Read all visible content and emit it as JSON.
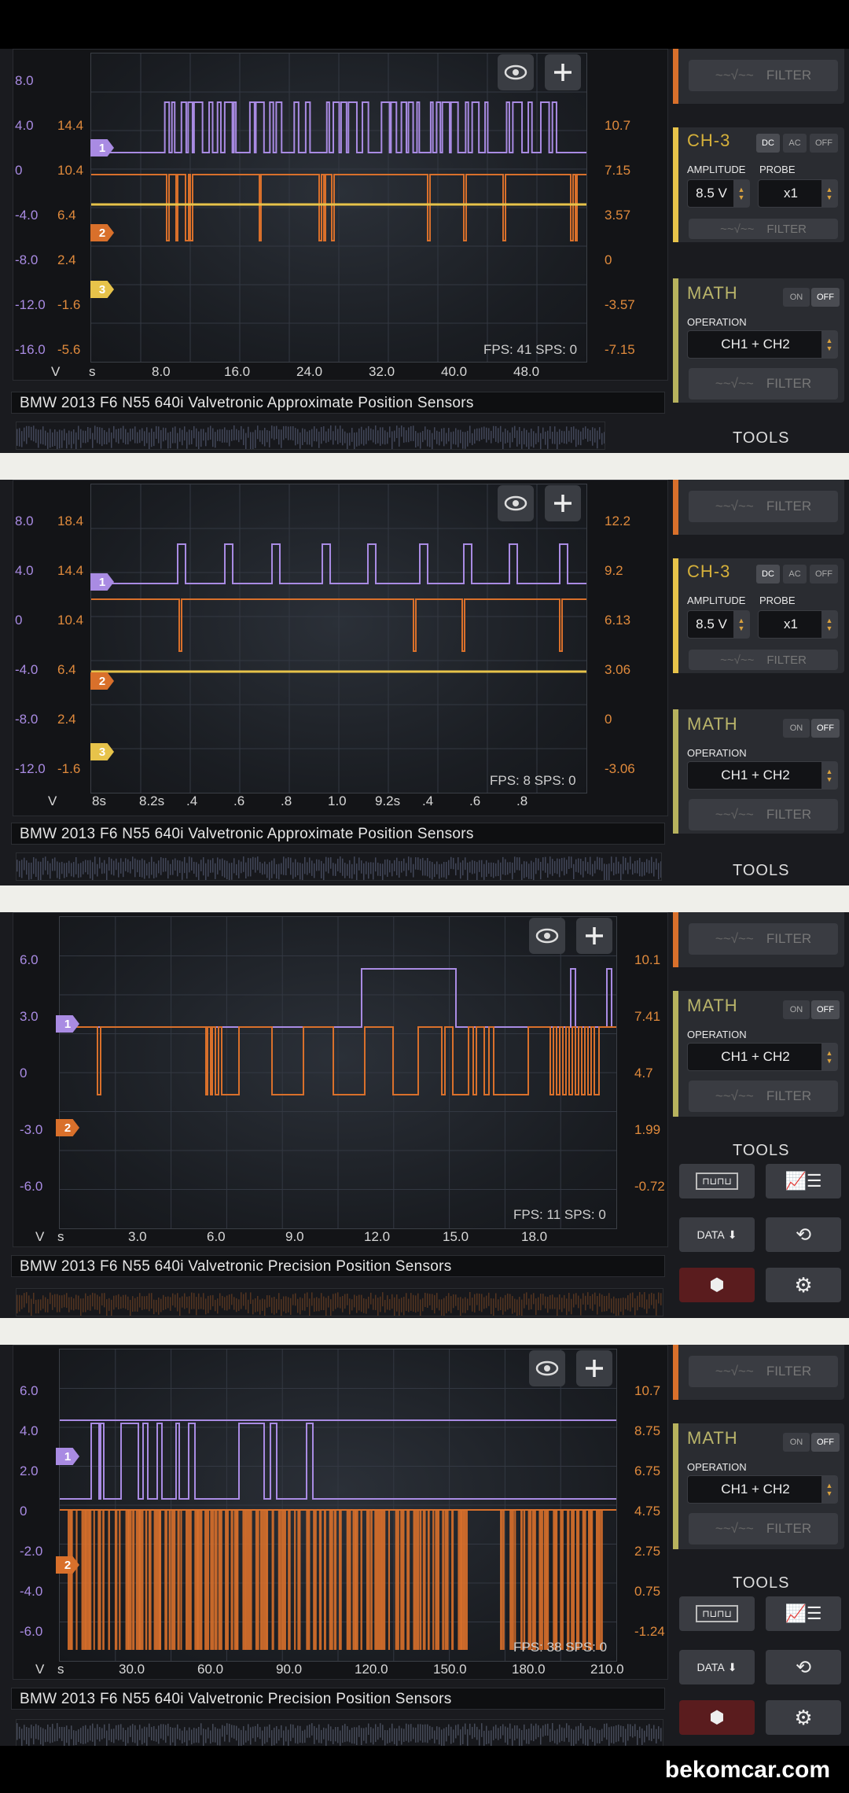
{
  "channel_colors": {
    "ch1": "#a98be3",
    "ch2": "#d9702b",
    "ch3": "#e7c34a",
    "math": "#b7b25d",
    "ch3_title": "#d6b13a"
  },
  "scopes": [
    {
      "title": "BMW 2013 F6 N55 640i Valvetronic Approximate Position Sensors",
      "left_axis_v": [
        "8.0",
        "4.0",
        "0",
        "-4.0",
        "-8.0",
        "-12.0",
        "-16.0"
      ],
      "left_axis_ch2": [
        "",
        "14.4",
        "10.4",
        "6.4",
        "2.4",
        "-1.6",
        "-5.6"
      ],
      "right_axis": [
        "",
        "10.7",
        "7.15",
        "3.57",
        "0",
        "-3.57",
        "-7.15"
      ],
      "x_ticks": [
        "8.0",
        "16.0",
        "24.0",
        "32.0",
        "40.0",
        "48.0"
      ],
      "x_unit_v": "V",
      "x_unit_s": "s",
      "fps": "FPS: 41  SPS: 0",
      "markers": [
        "1",
        "2",
        "3"
      ]
    },
    {
      "title": "BMW 2013 F6 N55 640i Valvetronic Approximate Position Sensors",
      "left_axis_v": [
        "8.0",
        "4.0",
        "0",
        "-4.0",
        "-8.0",
        "-12.0"
      ],
      "left_axis_ch2": [
        "18.4",
        "14.4",
        "10.4",
        "6.4",
        "2.4",
        "-1.6"
      ],
      "right_axis": [
        "12.2",
        "9.2",
        "6.13",
        "3.06",
        "0",
        "-3.06"
      ],
      "x_ticks": [
        "8s",
        "8.2s",
        ".4",
        ".6",
        ".8",
        "1.0",
        "9.2s",
        ".4",
        ".6",
        ".8"
      ],
      "x_unit_v": "V",
      "x_unit_s": "",
      "fps": "FPS: 8  SPS: 0",
      "markers": [
        "1",
        "2",
        "3"
      ]
    },
    {
      "title": "BMW 2013 F6 N55 640i Valvetronic Precision Position Sensors",
      "left_axis_v": [
        "6.0",
        "3.0",
        "0",
        "-3.0",
        "-6.0"
      ],
      "right_axis": [
        "10.1",
        "7.41",
        "4.7",
        "1.99",
        "-0.72"
      ],
      "x_ticks": [
        "3.0",
        "6.0",
        "9.0",
        "12.0",
        "15.0",
        "18.0"
      ],
      "x_unit_v": "V",
      "x_unit_s": "s",
      "fps": "FPS: 11  SPS: 0",
      "markers": [
        "1",
        "2"
      ]
    },
    {
      "title": "BMW 2013 F6 N55 640i Valvetronic Precision Position Sensors",
      "left_axis_v": [
        "6.0",
        "4.0",
        "2.0",
        "0",
        "-2.0",
        "-4.0",
        "-6.0"
      ],
      "right_axis": [
        "10.7",
        "8.75",
        "6.75",
        "4.75",
        "2.75",
        "0.75",
        "-1.24"
      ],
      "x_ticks": [
        "30.0",
        "60.0",
        "90.0",
        "120.0",
        "150.0",
        "180.0",
        "210.0"
      ],
      "x_unit_v": "V",
      "x_unit_s": "s",
      "fps": "FPS: 38  SPS: 0",
      "markers": [
        "1",
        "2"
      ]
    }
  ],
  "sidebar": {
    "filter_label": "FILTER",
    "ch3": {
      "title": "CH-3",
      "dc": "DC",
      "ac": "AC",
      "off": "OFF",
      "amplitude_label": "AMPLITUDE",
      "probe_label": "PROBE",
      "amplitude_value": "8.5 V",
      "probe_value": "x1"
    },
    "math": {
      "title": "MATH",
      "on": "ON",
      "off": "OFF",
      "operation_label": "OPERATION",
      "operation_value": "CH1 + CH2"
    },
    "tools_label": "TOOLS",
    "data_label": "DATA"
  },
  "brand": "bekomcar.com"
}
